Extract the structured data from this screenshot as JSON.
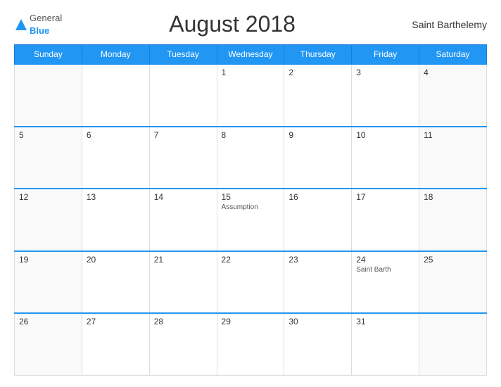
{
  "header": {
    "logo_general": "General",
    "logo_blue": "Blue",
    "title": "August 2018",
    "region": "Saint Barthelemy"
  },
  "days_of_week": [
    "Sunday",
    "Monday",
    "Tuesday",
    "Wednesday",
    "Thursday",
    "Friday",
    "Saturday"
  ],
  "weeks": [
    [
      {
        "date": "",
        "holiday": ""
      },
      {
        "date": "",
        "holiday": ""
      },
      {
        "date": "",
        "holiday": ""
      },
      {
        "date": "1",
        "holiday": ""
      },
      {
        "date": "2",
        "holiday": ""
      },
      {
        "date": "3",
        "holiday": ""
      },
      {
        "date": "4",
        "holiday": ""
      }
    ],
    [
      {
        "date": "5",
        "holiday": ""
      },
      {
        "date": "6",
        "holiday": ""
      },
      {
        "date": "7",
        "holiday": ""
      },
      {
        "date": "8",
        "holiday": ""
      },
      {
        "date": "9",
        "holiday": ""
      },
      {
        "date": "10",
        "holiday": ""
      },
      {
        "date": "11",
        "holiday": ""
      }
    ],
    [
      {
        "date": "12",
        "holiday": ""
      },
      {
        "date": "13",
        "holiday": ""
      },
      {
        "date": "14",
        "holiday": ""
      },
      {
        "date": "15",
        "holiday": "Assumption"
      },
      {
        "date": "16",
        "holiday": ""
      },
      {
        "date": "17",
        "holiday": ""
      },
      {
        "date": "18",
        "holiday": ""
      }
    ],
    [
      {
        "date": "19",
        "holiday": ""
      },
      {
        "date": "20",
        "holiday": ""
      },
      {
        "date": "21",
        "holiday": ""
      },
      {
        "date": "22",
        "holiday": ""
      },
      {
        "date": "23",
        "holiday": ""
      },
      {
        "date": "24",
        "holiday": "Saint Barth"
      },
      {
        "date": "25",
        "holiday": ""
      }
    ],
    [
      {
        "date": "26",
        "holiday": ""
      },
      {
        "date": "27",
        "holiday": ""
      },
      {
        "date": "28",
        "holiday": ""
      },
      {
        "date": "29",
        "holiday": ""
      },
      {
        "date": "30",
        "holiday": ""
      },
      {
        "date": "31",
        "holiday": ""
      },
      {
        "date": "",
        "holiday": ""
      }
    ]
  ]
}
